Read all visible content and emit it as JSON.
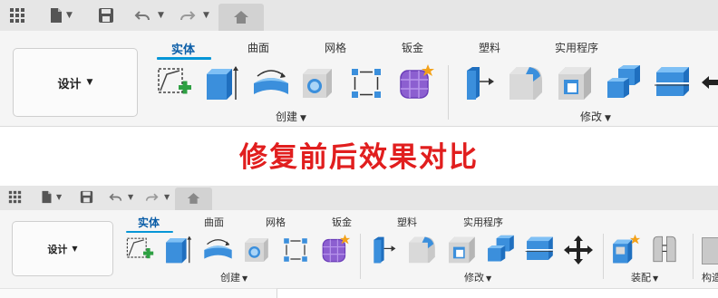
{
  "top": {
    "tabs": [
      "实体",
      "曲面",
      "网格",
      "钣金",
      "塑料",
      "实用程序"
    ],
    "workspace": "设计",
    "groups": {
      "create": "创建",
      "modify": "修改"
    }
  },
  "headline": "修复前后效果对比",
  "bottom": {
    "tabs": [
      "实体",
      "曲面",
      "网格",
      "钣金",
      "塑料",
      "实用程序"
    ],
    "workspace": "设计",
    "groups": {
      "create": "创建",
      "modify": "修改",
      "assemble": "装配",
      "construct": "构造"
    }
  },
  "icons": {
    "grid": "apps-grid-icon",
    "file": "file-icon",
    "save": "save-icon",
    "undo": "undo-icon",
    "redo": "redo-icon",
    "home": "home-icon",
    "sketch": "create-sketch-icon",
    "extrude": "extrude-icon",
    "revolve": "revolve-icon",
    "hole": "hole-icon",
    "pattern": "pattern-icon",
    "form": "form-icon",
    "press_pull": "press-pull-icon",
    "fillet": "fillet-icon",
    "shell": "shell-icon",
    "combine": "combine-icon",
    "split": "split-face-icon",
    "move": "move-icon",
    "new_component": "new-component-icon",
    "joint": "joint-icon"
  },
  "colors": {
    "accent": "#0696d7",
    "headline": "#e11e1e",
    "icon_blue": "#3b8fdc"
  }
}
